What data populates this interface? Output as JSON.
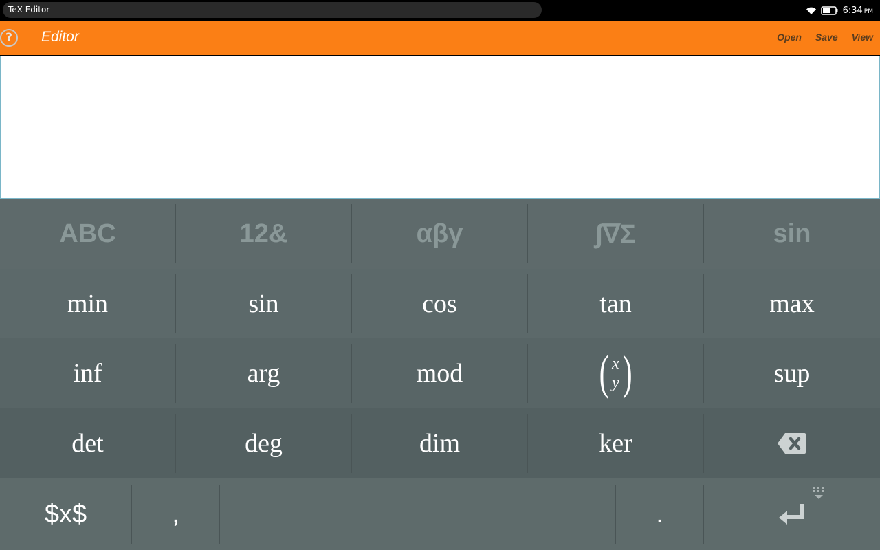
{
  "statusbar": {
    "app_title": "TeX Editor",
    "time": "6:34",
    "ampm": "PM"
  },
  "appbar": {
    "title": "Editor",
    "menu": [
      "Open",
      "Save",
      "View"
    ]
  },
  "editor": {
    "value": ""
  },
  "keyboard": {
    "tabs": [
      "ABC",
      "12&",
      "αβγ",
      "∫∇Σ",
      "sin"
    ],
    "row1": [
      "min",
      "sin",
      "cos",
      "tan",
      "max"
    ],
    "row2": [
      "inf",
      "arg",
      "mod",
      "sup"
    ],
    "matrix": {
      "top": "x",
      "bottom": "y"
    },
    "row3": [
      "det",
      "deg",
      "dim",
      "ker"
    ],
    "bottom": {
      "dollar": "$x$",
      "comma": ",",
      "period": "."
    }
  },
  "colors": {
    "accent": "#fb7f15",
    "keyboard_bg": "#5e6b6b"
  },
  "icons": [
    "help-icon",
    "wifi-icon",
    "battery-icon",
    "backspace-icon",
    "enter-icon",
    "keyboard-hide-icon"
  ]
}
